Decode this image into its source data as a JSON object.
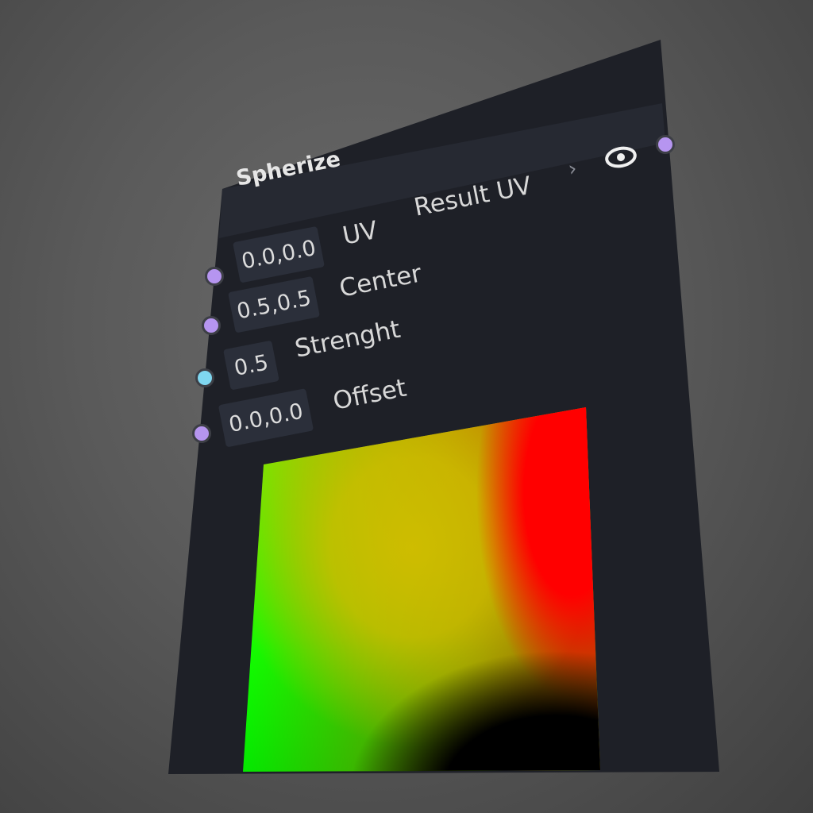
{
  "node": {
    "title": "Spherize",
    "output_label": "Result UV",
    "chevron": "›",
    "preview_icon": "eye-icon",
    "inputs": [
      {
        "label": "UV",
        "value": "0.0,0.0",
        "port_color": "#b695f0"
      },
      {
        "label": "Center",
        "value": "0.5,0.5",
        "port_color": "#b695f0"
      },
      {
        "label": "Strenght",
        "value": "0.5",
        "port_color": "#7fd7f0"
      },
      {
        "label": "Offset",
        "value": "0.0,0.0",
        "port_color": "#b695f0"
      }
    ],
    "output_port_color": "#b695f0"
  },
  "colors": {
    "background": "#5a5a5a",
    "panel": "#1e2027",
    "header": "#262932",
    "value_box": "#2b2f3a"
  }
}
